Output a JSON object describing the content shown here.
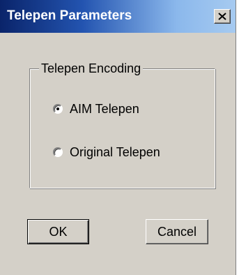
{
  "window": {
    "title": "Telepen Parameters"
  },
  "titlebar": {
    "close_icon": "close-icon",
    "colors": {
      "start": "#0a246a",
      "end": "#a6caf0"
    }
  },
  "group": {
    "label": "Telepen Encoding",
    "options": [
      {
        "label": "AIM Telepen",
        "selected": true
      },
      {
        "label": "Original Telepen",
        "selected": false
      }
    ]
  },
  "buttons": {
    "ok_label": "OK",
    "cancel_label": "Cancel"
  },
  "colors": {
    "dialog_background": "#d4d0c8"
  }
}
